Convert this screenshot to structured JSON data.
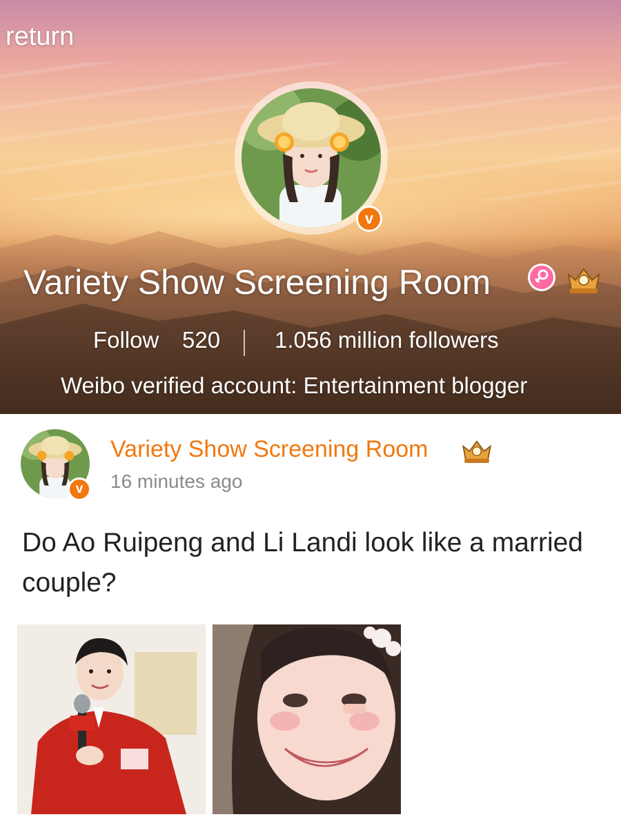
{
  "header": {
    "return_label": "return",
    "profile_name": "Variety Show Screening Room",
    "follow_label": "Follow",
    "follow_count": "520",
    "followers_text": "1.056 million followers",
    "verification": "Weibo verified account: Entertainment blogger",
    "verified_mark": "v"
  },
  "post": {
    "author": "Variety Show Screening Room",
    "time": "16 minutes ago",
    "text": "Do Ao Ruipeng and Li Landi look like a married couple?",
    "verified_mark": "v"
  },
  "icons": {
    "female": "female-gender-icon",
    "crown": "crown-level-icon",
    "verified": "verified-v-icon"
  },
  "colors": {
    "accent_orange": "#f0780f",
    "female_pink": "#ff6aa3",
    "time_gray": "#8a8a8a"
  }
}
